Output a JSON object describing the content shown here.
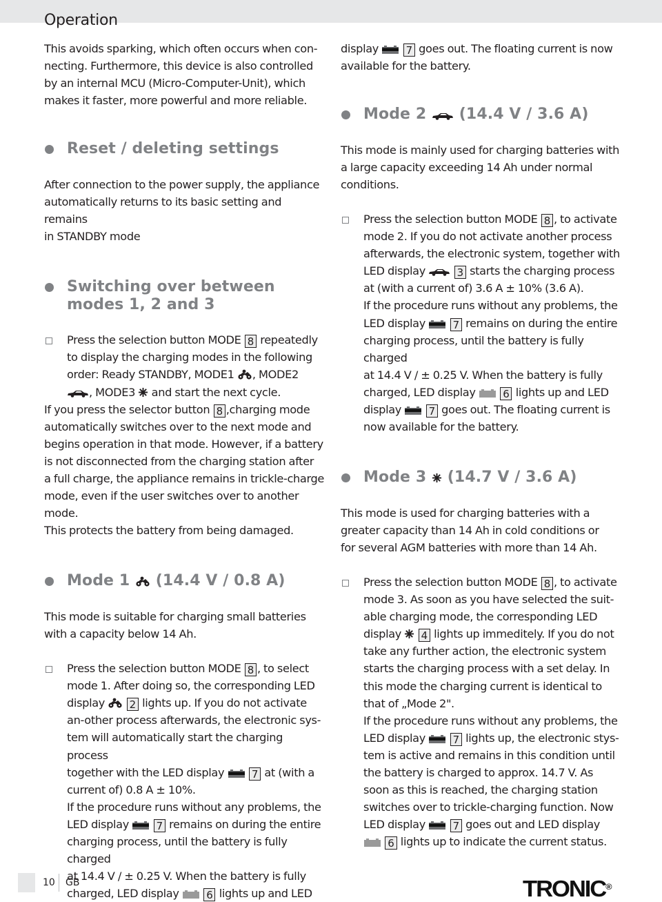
{
  "header": {
    "title": "Operation"
  },
  "left": {
    "intro": [
      "This avoids sparking, which often occurs when con-",
      "necting. Furthermore, this device is also controlled",
      "by an internal MCU (Micro-Computer-Unit), which",
      "makes it faster, more powerful and more reliable."
    ],
    "reset": {
      "heading": "Reset / deleting settings",
      "body": [
        "After connection to the power supply, the appliance",
        "automatically returns to its basic setting and remains",
        "in STANDBY mode"
      ]
    },
    "switching": {
      "heading": [
        "Switching over between",
        "modes 1, 2 and 3"
      ],
      "bullet": {
        "l1a": "Press the selection button MODE",
        "l1num": "8",
        "l1b": "repeatedly",
        "l2": "to display the charging modes in the following",
        "l3a": "order: Ready STANDBY, MODE1",
        "l3b": ", MODE2",
        "l4a": ", MODE3",
        "l4b": "and start the next cycle."
      },
      "after": {
        "l1a": "If you press the selector button",
        "l1num": "8",
        "l1b": ",charging mode",
        "rest": [
          "automatically switches over to the next mode and",
          "begins operation in that mode. However, if a battery",
          "is not disconnected from the charging station after",
          "a full charge, the appliance remains in trickle-charge",
          "mode, even if the user switches over to another mode.",
          "This protects the battery from being damaged."
        ]
      }
    },
    "mode1": {
      "heading_a": "Mode 1",
      "heading_b": "(14.4 V / 0.8 A)",
      "body": [
        "This mode is suitable for charging small batteries",
        "with a capacity below 14 Ah."
      ],
      "bullet": {
        "l1a": "Press the selection button MODE",
        "l1num": "8",
        "l1b": ", to select",
        "l2": "mode 1. After doing so, the corresponding LED",
        "l3a": "display",
        "l3num": "2",
        "l3b": "lights up. If you do not activate",
        "l4": "an-other process afterwards, the electronic sys-",
        "l5": "tem will automatically start the charging process",
        "l6a": "together with the LED display",
        "l6num": "7",
        "l6b": "at (with a",
        "l7": "current of) 0.8 A ± 10%.",
        "l8": "If the procedure runs without any problems, the",
        "l9a": "LED display",
        "l9num": "7",
        "l9b": "remains on during the entire",
        "l10": "charging process, until the battery is fully charged",
        "l11": "at 14.4 V / ± 0.25 V. When the battery is fully",
        "l12a": "charged, LED display",
        "l12num": "6",
        "l12b": "lights up and LED"
      }
    }
  },
  "right": {
    "cont": {
      "l1a": "display",
      "l1num": "7",
      "l1b": "goes out. The floating current is now",
      "l2": "available for the battery."
    },
    "mode2": {
      "heading_a": "Mode 2",
      "heading_b": "(14.4 V / 3.6 A)",
      "body": [
        "This mode is mainly used for charging batteries with",
        "a large capacity exceeding 14 Ah under normal",
        "conditions."
      ],
      "bullet": {
        "l1a": "Press the selection button MODE",
        "l1num": "8",
        "l1b": ", to activate",
        "l2": "mode 2. If you do not activate another process",
        "l3": "afterwards, the electronic system, together with",
        "l4a": "LED display",
        "l4num": "3",
        "l4b": "starts the charging process",
        "l5": "at (with a current of) 3.6 A ± 10% (3.6 A).",
        "l6": "If the procedure runs without any problems, the",
        "l7a": "LED display",
        "l7num": "7",
        "l7b": "remains on during the entire",
        "l8": "charging process, until the battery is fully charged",
        "l9": "at 14.4 V / ± 0.25 V. When the battery is fully",
        "l10a": "charged, LED display",
        "l10num": "6",
        "l10b": "lights up and LED",
        "l11a": "display",
        "l11num": "7",
        "l11b": "goes out. The floating current is",
        "l12": "now available for the battery."
      }
    },
    "mode3": {
      "heading_a": "Mode 3",
      "heading_b": "(14.7 V / 3.6 A)",
      "body": [
        "This mode is used for charging batteries with a",
        "greater capacity than 14 Ah in cold conditions or",
        "for several AGM batteries with more than 14 Ah."
      ],
      "bullet": {
        "l1a": "Press the selection button MODE",
        "l1num": "8",
        "l1b": ", to activate",
        "l2": "mode 3. As soon as you have selected the suit-",
        "l3": "able charging mode, the corresponding LED",
        "l4a": "display",
        "l4num": "4",
        "l4b": "lights up immeditely. If you do not",
        "l5": "take any further action, the electronic system",
        "l6": "starts the charging process with a set delay. In",
        "l7": "this mode the charging current is identical to",
        "l8": "that of „Mode 2\".",
        "l9": "If the procedure runs without any problems, the",
        "l10a": "LED display",
        "l10num": "7",
        "l10b": "lights up, the electronic stys-",
        "l11": "tem is active and remains in this condition until",
        "l12": "the battery is charged to approx. 14.7 V. As",
        "l13": "soon as this is reached, the charging station",
        "l14": "switches over to trickle-charging function. Now",
        "l15a": "LED display",
        "l15num": "7",
        "l15b": "goes out and LED display",
        "l16num": "6",
        "l16b": "lights up to indicate the current status."
      }
    }
  },
  "footer": {
    "page": "10",
    "lang": "GB",
    "brand": "TRONIC",
    "brand_mark": "®"
  },
  "icons": {
    "mode1": "motorcycle-icon",
    "mode2": "car-icon",
    "mode3": "snowflake-icon",
    "charging": "battery-charging-icon",
    "full": "battery-full-icon"
  },
  "colors": {
    "heading": "#808285",
    "header_bar": "#e6e7e8",
    "text": "#231f20"
  }
}
